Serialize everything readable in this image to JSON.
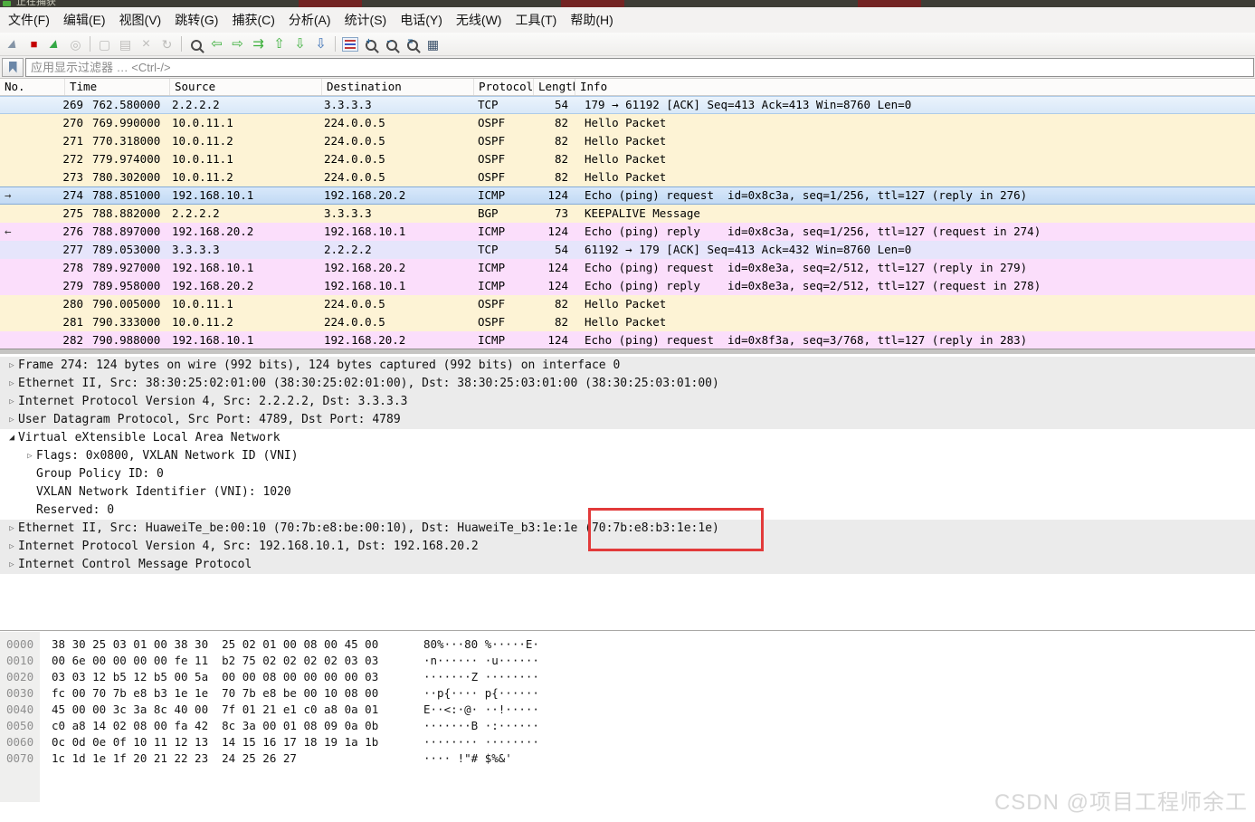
{
  "window": {
    "title": "正在捕获"
  },
  "menu": {
    "items": [
      "文件(F)",
      "编辑(E)",
      "视图(V)",
      "跳转(G)",
      "捕获(C)",
      "分析(A)",
      "统计(S)",
      "电话(Y)",
      "无线(W)",
      "工具(T)",
      "帮助(H)"
    ]
  },
  "toolbar": {
    "icons": [
      {
        "name": "start-capture-icon",
        "glyph": "▲"
      },
      {
        "name": "stop-capture-icon",
        "glyph": "■"
      },
      {
        "name": "restart-capture-icon",
        "glyph": "▲"
      },
      {
        "name": "capture-options-icon",
        "glyph": "◎"
      },
      {
        "name": "open-file-icon",
        "glyph": "▢"
      },
      {
        "name": "save-file-icon",
        "glyph": "▤"
      },
      {
        "name": "close-file-icon",
        "glyph": "×"
      },
      {
        "name": "reload-icon",
        "glyph": "↻"
      },
      {
        "name": "find-packet-icon",
        "glyph": ""
      },
      {
        "name": "go-back-icon",
        "glyph": "⇦"
      },
      {
        "name": "go-forward-icon",
        "glyph": "⇨"
      },
      {
        "name": "go-to-packet-icon",
        "glyph": "⇉"
      },
      {
        "name": "go-first-icon",
        "glyph": "⇧"
      },
      {
        "name": "go-last-icon",
        "glyph": "⇩"
      },
      {
        "name": "auto-scroll-icon",
        "glyph": "⇩"
      },
      {
        "name": "colorize-icon",
        "glyph": ""
      },
      {
        "name": "zoom-in-icon",
        "glyph": "+"
      },
      {
        "name": "zoom-out-icon",
        "glyph": "−"
      },
      {
        "name": "zoom-original-icon",
        "glyph": "="
      },
      {
        "name": "resize-columns-icon",
        "glyph": "▦"
      }
    ]
  },
  "filter": {
    "placeholder": "应用显示过滤器 … <Ctrl-/>"
  },
  "packet_list": {
    "columns": [
      "No.",
      "Time",
      "Source",
      "Destination",
      "Protocol",
      "Length",
      "Info"
    ],
    "rows": [
      {
        "marker": "",
        "no": "269",
        "time": "762.580000",
        "source": "2.2.2.2",
        "destination": "3.3.3.3",
        "protocol": "TCP",
        "length": "54",
        "info": "179 → 61192 [ACK] Seq=413 Ack=413 Win=8760 Len=0"
      },
      {
        "marker": "",
        "no": "270",
        "time": "769.990000",
        "source": "10.0.11.1",
        "destination": "224.0.0.5",
        "protocol": "OSPF",
        "length": "82",
        "info": "Hello Packet"
      },
      {
        "marker": "",
        "no": "271",
        "time": "770.318000",
        "source": "10.0.11.2",
        "destination": "224.0.0.5",
        "protocol": "OSPF",
        "length": "82",
        "info": "Hello Packet"
      },
      {
        "marker": "",
        "no": "272",
        "time": "779.974000",
        "source": "10.0.11.1",
        "destination": "224.0.0.5",
        "protocol": "OSPF",
        "length": "82",
        "info": "Hello Packet"
      },
      {
        "marker": "",
        "no": "273",
        "time": "780.302000",
        "source": "10.0.11.2",
        "destination": "224.0.0.5",
        "protocol": "OSPF",
        "length": "82",
        "info": "Hello Packet"
      },
      {
        "marker": "→",
        "no": "274",
        "time": "788.851000",
        "source": "192.168.10.1",
        "destination": "192.168.20.2",
        "protocol": "ICMP",
        "length": "124",
        "info": "Echo (ping) request  id=0x8c3a, seq=1/256, ttl=127 (reply in 276)"
      },
      {
        "marker": "",
        "no": "275",
        "time": "788.882000",
        "source": "2.2.2.2",
        "destination": "3.3.3.3",
        "protocol": "BGP",
        "length": "73",
        "info": "KEEPALIVE Message"
      },
      {
        "marker": "←",
        "no": "276",
        "time": "788.897000",
        "source": "192.168.20.2",
        "destination": "192.168.10.1",
        "protocol": "ICMP",
        "length": "124",
        "info": "Echo (ping) reply    id=0x8c3a, seq=1/256, ttl=127 (request in 274)"
      },
      {
        "marker": "",
        "no": "277",
        "time": "789.053000",
        "source": "3.3.3.3",
        "destination": "2.2.2.2",
        "protocol": "TCP",
        "length": "54",
        "info": "61192 → 179 [ACK] Seq=413 Ack=432 Win=8760 Len=0"
      },
      {
        "marker": "",
        "no": "278",
        "time": "789.927000",
        "source": "192.168.10.1",
        "destination": "192.168.20.2",
        "protocol": "ICMP",
        "length": "124",
        "info": "Echo (ping) request  id=0x8e3a, seq=2/512, ttl=127 (reply in 279)"
      },
      {
        "marker": "",
        "no": "279",
        "time": "789.958000",
        "source": "192.168.20.2",
        "destination": "192.168.10.1",
        "protocol": "ICMP",
        "length": "124",
        "info": "Echo (ping) reply    id=0x8e3a, seq=2/512, ttl=127 (request in 278)"
      },
      {
        "marker": "",
        "no": "280",
        "time": "790.005000",
        "source": "10.0.11.1",
        "destination": "224.0.0.5",
        "protocol": "OSPF",
        "length": "82",
        "info": "Hello Packet"
      },
      {
        "marker": "",
        "no": "281",
        "time": "790.333000",
        "source": "10.0.11.2",
        "destination": "224.0.0.5",
        "protocol": "OSPF",
        "length": "82",
        "info": "Hello Packet"
      },
      {
        "marker": "",
        "no": "282",
        "time": "790.988000",
        "source": "192.168.10.1",
        "destination": "192.168.20.2",
        "protocol": "ICMP",
        "length": "124",
        "info": "Echo (ping) request  id=0x8f3a, seq=3/768, ttl=127 (reply in 283)"
      }
    ]
  },
  "details": {
    "lines": [
      {
        "expander": "▷",
        "text": "Frame 274: 124 bytes on wire (992 bits), 124 bytes captured (992 bits) on interface 0"
      },
      {
        "expander": "▷",
        "text": "Ethernet II, Src: 38:30:25:02:01:00 (38:30:25:02:01:00), Dst: 38:30:25:03:01:00 (38:30:25:03:01:00)"
      },
      {
        "expander": "▷",
        "text": "Internet Protocol Version 4, Src: 2.2.2.2, Dst: 3.3.3.3"
      },
      {
        "expander": "▷",
        "text": "User Datagram Protocol, Src Port: 4789, Dst Port: 4789"
      },
      {
        "expander": "◢",
        "text": "Virtual eXtensible Local Area Network"
      },
      {
        "expander": "▷",
        "text": "Flags: 0x0800, VXLAN Network ID (VNI)"
      },
      {
        "expander": "",
        "text": "Group Policy ID: 0"
      },
      {
        "expander": "",
        "text": "VXLAN Network Identifier (VNI): 1020"
      },
      {
        "expander": "",
        "text": "Reserved: 0"
      },
      {
        "expander": "▷",
        "text": "Ethernet II, Src: HuaweiTe_be:00:10 (70:7b:e8:be:00:10), Dst: HuaweiTe_b3:1e:1e ",
        "boxed": "(70:7b:e8:b3:1e:1e)"
      },
      {
        "expander": "▷",
        "text": "Internet Protocol Version 4, Src: 192.168.10.1, Dst: 192.168.20.2"
      },
      {
        "expander": "▷",
        "text": "Internet Control Message Protocol"
      }
    ],
    "annotation_color": "#e23a3a"
  },
  "hex": {
    "rows": [
      {
        "offset": "0000",
        "bytes": "38 30 25 03 01 00 38 30  25 02 01 00 08 00 45 00",
        "ascii": "80%···80 %·····E·"
      },
      {
        "offset": "0010",
        "bytes": "00 6e 00 00 00 00 fe 11  b2 75 02 02 02 02 03 03",
        "ascii": "·n······ ·u······"
      },
      {
        "offset": "0020",
        "bytes": "03 03 12 b5 12 b5 00 5a  00 00 08 00 00 00 00 03",
        "ascii": "·······Z ········"
      },
      {
        "offset": "0030",
        "bytes": "fc 00 70 7b e8 b3 1e 1e  70 7b e8 be 00 10 08 00",
        "ascii": "··p{···· p{······"
      },
      {
        "offset": "0040",
        "bytes": "45 00 00 3c 3a 8c 40 00  7f 01 21 e1 c0 a8 0a 01",
        "ascii": "E··<:·@· ··!·····"
      },
      {
        "offset": "0050",
        "bytes": "c0 a8 14 02 08 00 fa 42  8c 3a 00 01 08 09 0a 0b",
        "ascii": "·······B ·:······"
      },
      {
        "offset": "0060",
        "bytes": "0c 0d 0e 0f 10 11 12 13  14 15 16 17 18 19 1a 1b",
        "ascii": "········ ········"
      },
      {
        "offset": "0070",
        "bytes": "1c 1d 1e 1f 20 21 22 23  24 25 26 27",
        "ascii": "···· !\"# $%&'"
      }
    ]
  },
  "row_colors": {
    "tcp": "#e6e5fb",
    "routing": "#fdf3d5",
    "icmp": "#fbdefb",
    "selected": "#c2daf4"
  },
  "watermark": {
    "text": "CSDN @项目工程师余工"
  }
}
